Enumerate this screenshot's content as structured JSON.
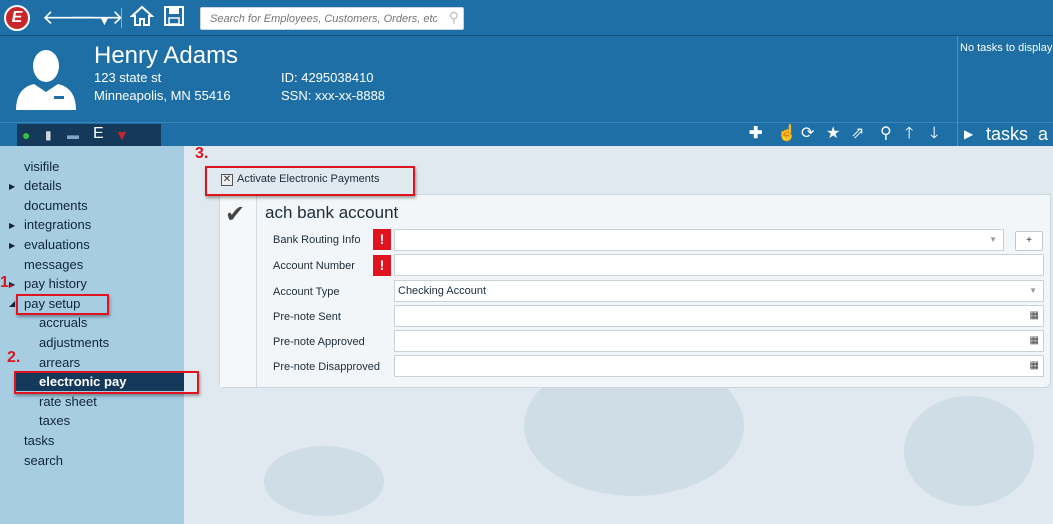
{
  "toolbar": {
    "logo_letter": "E",
    "search_placeholder": "Search for Employees, Customers, Orders, etc."
  },
  "employee": {
    "name": "Henry Adams",
    "address_line1": "123 state st",
    "address_line2": "Minneapolis, MN 55416",
    "id": "ID: 4295038410",
    "ssn": "SSN: xxx-xx-8888"
  },
  "tasks_panel": {
    "message": "No tasks to display",
    "header_label": "tasks",
    "header_extra": "a"
  },
  "status_strip": {
    "e_label": "E"
  },
  "sidebar": {
    "items": [
      {
        "label": "visifile",
        "expandable": false
      },
      {
        "label": "details",
        "expandable": true
      },
      {
        "label": "documents",
        "expandable": false
      },
      {
        "label": "integrations",
        "expandable": true
      },
      {
        "label": "evaluations",
        "expandable": true
      },
      {
        "label": "messages",
        "expandable": false
      },
      {
        "label": "pay history",
        "expandable": true
      },
      {
        "label": "pay setup",
        "expandable": true,
        "expanded": true
      },
      {
        "label": "accruals",
        "sub": true
      },
      {
        "label": "adjustments",
        "sub": true
      },
      {
        "label": "arrears",
        "sub": true
      },
      {
        "label": "electronic pay",
        "sub": true,
        "active": true
      },
      {
        "label": "rate sheet",
        "sub": true
      },
      {
        "label": "taxes",
        "sub": true
      },
      {
        "label": "tasks",
        "expandable": false
      },
      {
        "label": "search",
        "expandable": false
      }
    ]
  },
  "annotations": {
    "step1": "1.",
    "step2": "2.",
    "step3": "3."
  },
  "main": {
    "activate_label": "Activate Electronic Payments",
    "activate_checked": true,
    "card_title": "ach bank account",
    "fields": {
      "routing_label": "Bank Routing Info",
      "routing_value": "",
      "account_number_label": "Account Number",
      "account_number_value": "",
      "account_type_label": "Account Type",
      "account_type_value": "Checking Account",
      "prenote_sent_label": "Pre-note Sent",
      "prenote_approved_label": "Pre-note Approved",
      "prenote_disapproved_label": "Pre-note Disapproved"
    },
    "warning_mark": "!",
    "add_button_label": "+"
  },
  "colors": {
    "brand_blue": "#1d6fa5",
    "dark_navy": "#14395a",
    "sidebar_bg": "#a7cde2",
    "annotation_red": "#e0141e"
  }
}
